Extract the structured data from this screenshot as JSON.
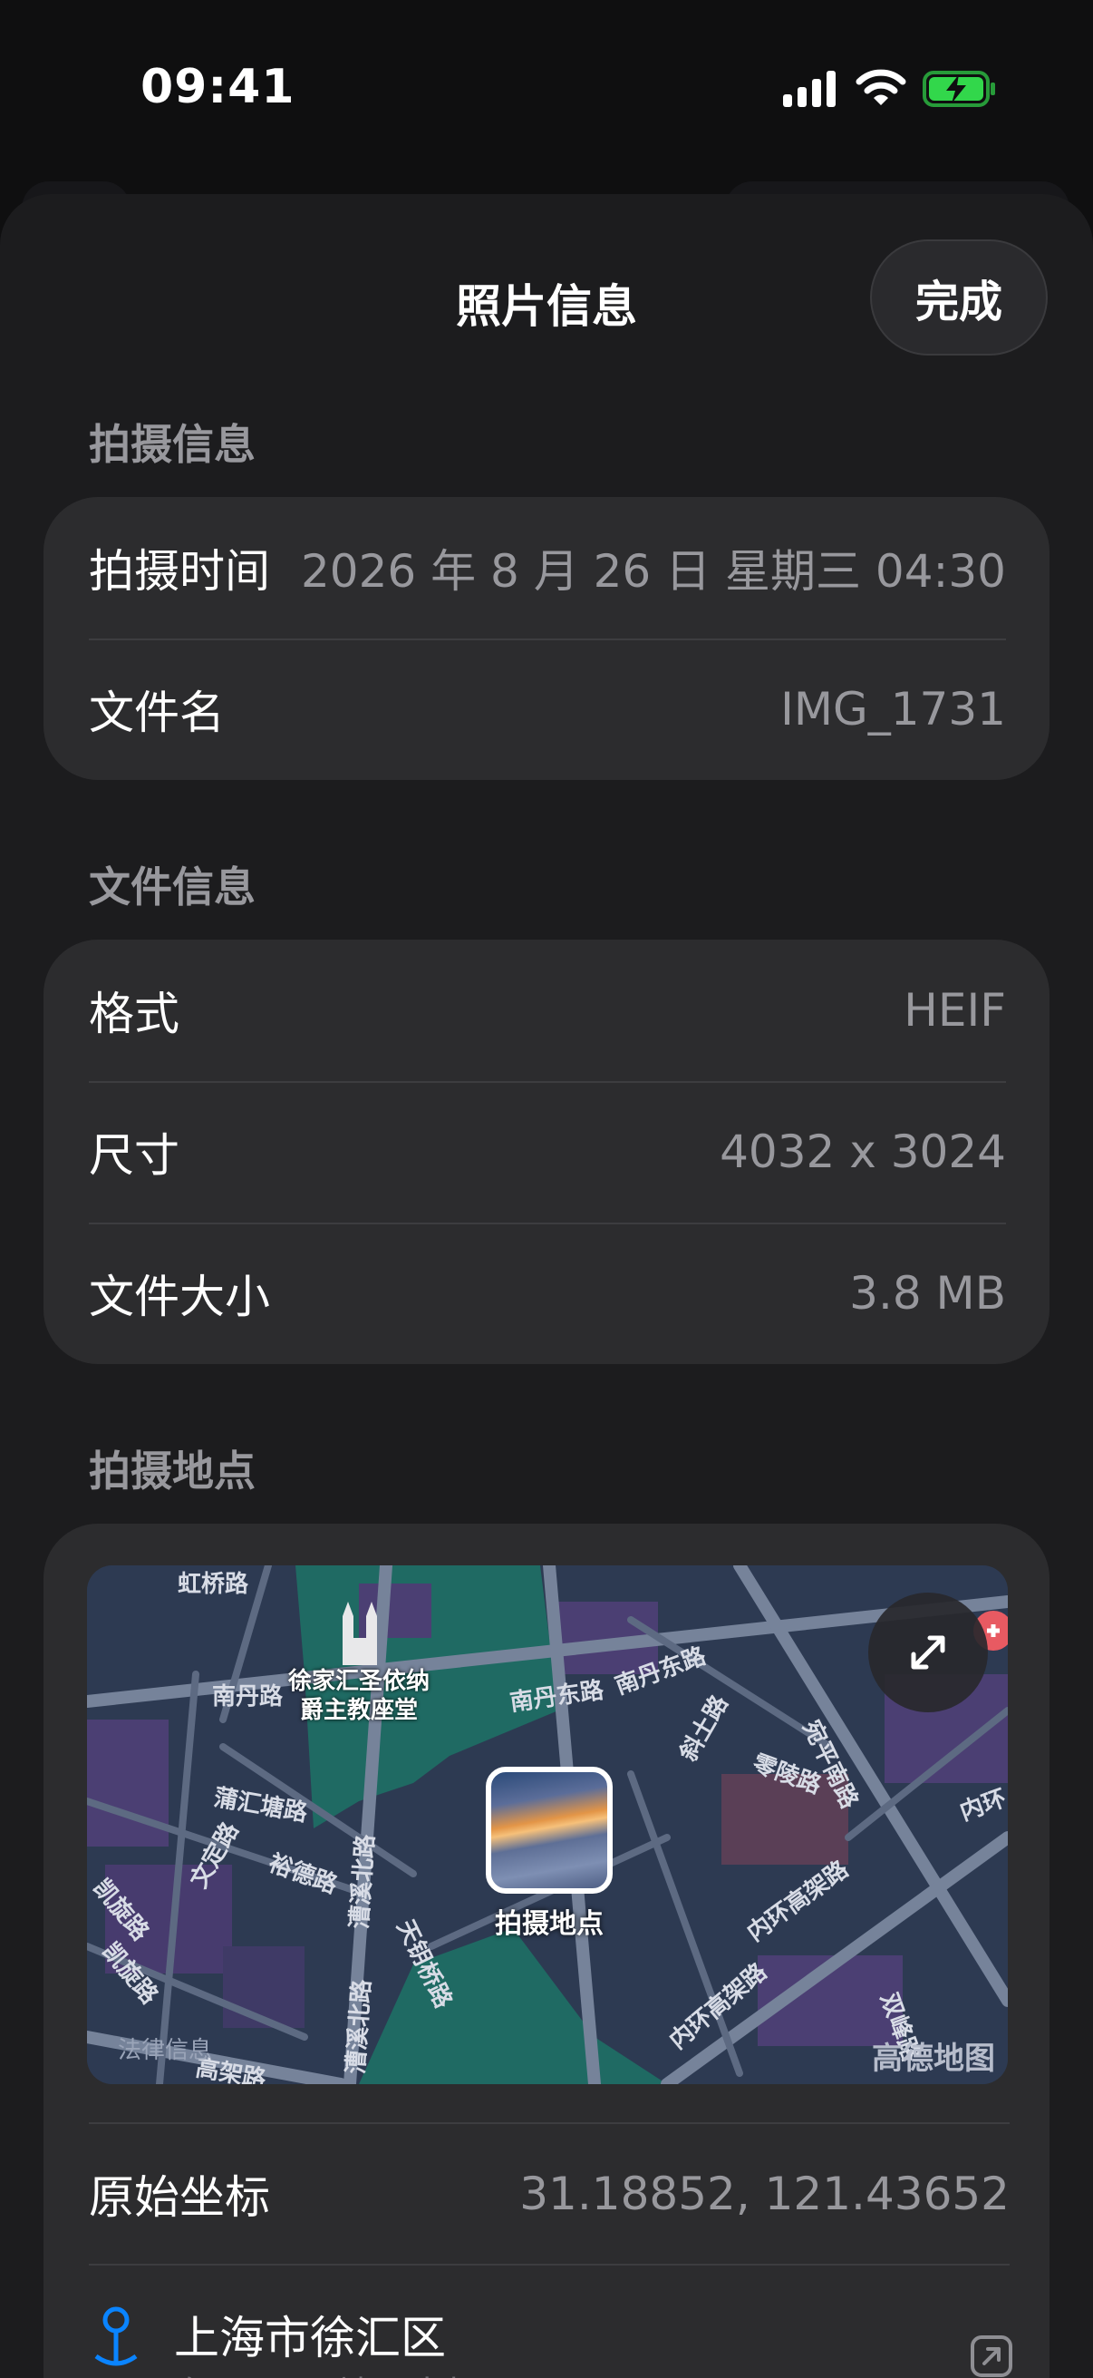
{
  "status": {
    "time": "09:41"
  },
  "sheet": {
    "title": "照片信息",
    "done_label": "完成"
  },
  "capture_info": {
    "header": "拍摄信息",
    "rows": [
      {
        "label": "拍摄时间",
        "value": "2026 年 8 月 26 日 星期三 04:30"
      },
      {
        "label": "文件名",
        "value": "IMG_1731"
      }
    ]
  },
  "file_info": {
    "header": "文件信息",
    "rows": [
      {
        "label": "格式",
        "value": "HEIF"
      },
      {
        "label": "尺寸",
        "value": "4032 x 3024"
      },
      {
        "label": "文件大小",
        "value": "3.8 MB"
      }
    ]
  },
  "location": {
    "header": "拍摄地点",
    "map": {
      "pin_label": "拍摄地点",
      "landmark": "徐家汇圣依纳爵主教座堂",
      "landmark_line1": "徐家汇圣依纳",
      "landmark_line2": "爵主教座堂",
      "legal": "法律信息",
      "provider": "高德地图",
      "streets": [
        "虹桥路",
        "南丹路",
        "南丹东路",
        "南丹东路",
        "宛平南路",
        "蒲汇塘路",
        "文定路",
        "裕德路",
        "漕溪北路",
        "漕溪北路",
        "天钥桥路",
        "凯旋路",
        "凯旋路",
        "内环高架路",
        "内环高架路",
        "内环",
        "零陵路",
        "斜土路",
        "双峰路",
        "高架路"
      ]
    },
    "coord_label": "原始坐标",
    "coord_value": "31.18852, 121.43652",
    "place_title": "上海市徐汇区",
    "place_sub": "在 Apple 地图中打开"
  }
}
